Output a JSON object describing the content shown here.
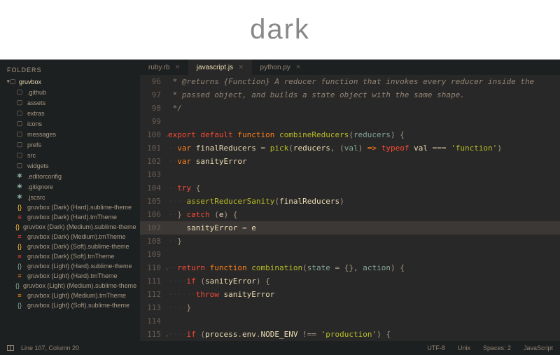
{
  "header": {
    "title": "dark"
  },
  "sidebar": {
    "heading": "FOLDERS",
    "root": "gruvbox",
    "items": [
      {
        "icon": "folder",
        "label": ".github"
      },
      {
        "icon": "folder",
        "label": "assets"
      },
      {
        "icon": "folder",
        "label": "extras"
      },
      {
        "icon": "folder",
        "label": "icons"
      },
      {
        "icon": "folder",
        "label": "messages"
      },
      {
        "icon": "folder",
        "label": "prefs"
      },
      {
        "icon": "folder",
        "label": "src"
      },
      {
        "icon": "folder",
        "label": "widgets"
      },
      {
        "icon": "conf",
        "label": ".editorconfig"
      },
      {
        "icon": "conf",
        "label": ".gitignore"
      },
      {
        "icon": "conf",
        "label": ".jscsrc"
      },
      {
        "icon": "braces-y",
        "label": "gruvbox (Dark) (Hard).sublime-theme"
      },
      {
        "icon": "settings-r",
        "label": "gruvbox (Dark) (Hard).tmTheme"
      },
      {
        "icon": "braces-y",
        "label": "gruvbox (Dark) (Medium).sublime-theme"
      },
      {
        "icon": "settings-r",
        "label": "gruvbox (Dark) (Medium).tmTheme"
      },
      {
        "icon": "braces-y",
        "label": "gruvbox (Dark) (Soft).sublime-theme"
      },
      {
        "icon": "settings-r",
        "label": "gruvbox (Dark) (Soft).tmTheme"
      },
      {
        "icon": "braces-b",
        "label": "gruvbox (Light) (Hard).sublime-theme"
      },
      {
        "icon": "settings-o",
        "label": "gruvbox (Light) (Hard).tmTheme"
      },
      {
        "icon": "braces-b",
        "label": "gruvbox (Light) (Medium).sublime-theme"
      },
      {
        "icon": "settings-o",
        "label": "gruvbox (Light) (Medium).tmTheme"
      },
      {
        "icon": "braces-b",
        "label": "gruvbox (Light) (Soft).sublime-theme"
      }
    ]
  },
  "tabs": [
    {
      "label": "ruby.rb",
      "active": false
    },
    {
      "label": "javascript.js",
      "active": true
    },
    {
      "label": "python.py",
      "active": false
    }
  ],
  "code": {
    "lines": [
      {
        "n": 96,
        "tokens": [
          [
            "comment",
            " * @returns {Function} A reducer function that invokes every reducer inside the"
          ]
        ]
      },
      {
        "n": 97,
        "tokens": [
          [
            "comment",
            " * passed object, and builds a state object with the same shape."
          ]
        ]
      },
      {
        "n": 98,
        "tokens": [
          [
            "comment",
            " */"
          ]
        ]
      },
      {
        "n": 99,
        "tokens": []
      },
      {
        "n": 100,
        "fold": true,
        "tokens": [
          [
            "kw",
            "export"
          ],
          [
            "prop",
            " "
          ],
          [
            "kw",
            "default"
          ],
          [
            "prop",
            " "
          ],
          [
            "storage",
            "function"
          ],
          [
            "prop",
            " "
          ],
          [
            "fn",
            "combineReducers"
          ],
          [
            "punc",
            "("
          ],
          [
            "param",
            "reducers"
          ],
          [
            "punc",
            ")"
          ],
          [
            "prop",
            " "
          ],
          [
            "punc",
            "{"
          ]
        ]
      },
      {
        "n": 101,
        "tokens": [
          [
            "ws",
            "··"
          ],
          [
            "storage",
            "var"
          ],
          [
            "prop",
            " finalReducers "
          ],
          [
            "punc",
            "="
          ],
          [
            "prop",
            " "
          ],
          [
            "fn",
            "pick"
          ],
          [
            "punc",
            "("
          ],
          [
            "prop",
            "reducers"
          ],
          [
            "punc",
            ", ("
          ],
          [
            "param",
            "val"
          ],
          [
            "punc",
            ")"
          ],
          [
            "prop",
            " "
          ],
          [
            "storage",
            "=>"
          ],
          [
            "prop",
            " "
          ],
          [
            "kw",
            "typeof"
          ],
          [
            "prop",
            " val "
          ],
          [
            "punc",
            "==="
          ],
          [
            "prop",
            " "
          ],
          [
            "str",
            "'function'"
          ],
          [
            "punc",
            ")"
          ]
        ]
      },
      {
        "n": 102,
        "tokens": [
          [
            "ws",
            "··"
          ],
          [
            "storage",
            "var"
          ],
          [
            "prop",
            " sanityError"
          ]
        ]
      },
      {
        "n": 103,
        "tokens": []
      },
      {
        "n": 104,
        "tokens": [
          [
            "ws",
            "··"
          ],
          [
            "kw",
            "try"
          ],
          [
            "prop",
            " "
          ],
          [
            "punc",
            "{"
          ]
        ]
      },
      {
        "n": 105,
        "tokens": [
          [
            "ws",
            "····"
          ],
          [
            "fn",
            "assertReducerSanity"
          ],
          [
            "punc",
            "("
          ],
          [
            "prop",
            "finalReducers"
          ],
          [
            "punc",
            ")"
          ]
        ]
      },
      {
        "n": 106,
        "tokens": [
          [
            "ws",
            "··"
          ],
          [
            "punc",
            "}"
          ],
          [
            "prop",
            " "
          ],
          [
            "kw",
            "catch"
          ],
          [
            "prop",
            " "
          ],
          [
            "punc",
            "("
          ],
          [
            "prop",
            "e"
          ],
          [
            "punc",
            ")"
          ],
          [
            "prop",
            " "
          ],
          [
            "punc",
            "{"
          ]
        ]
      },
      {
        "n": 107,
        "hl": true,
        "tokens": [
          [
            "ws",
            "····"
          ],
          [
            "prop",
            "sanityError "
          ],
          [
            "punc",
            "="
          ],
          [
            "prop",
            " e"
          ]
        ]
      },
      {
        "n": 108,
        "tokens": [
          [
            "ws",
            "··"
          ],
          [
            "punc",
            "}"
          ]
        ]
      },
      {
        "n": 109,
        "tokens": []
      },
      {
        "n": 110,
        "fold": true,
        "tokens": [
          [
            "ws",
            "··"
          ],
          [
            "kw",
            "return"
          ],
          [
            "prop",
            " "
          ],
          [
            "storage",
            "function"
          ],
          [
            "prop",
            " "
          ],
          [
            "fn",
            "combination"
          ],
          [
            "punc",
            "("
          ],
          [
            "param",
            "state"
          ],
          [
            "prop",
            " "
          ],
          [
            "punc",
            "="
          ],
          [
            "prop",
            " "
          ],
          [
            "punc",
            "{}, "
          ],
          [
            "param",
            "action"
          ],
          [
            "punc",
            ")"
          ],
          [
            "prop",
            " "
          ],
          [
            "punc",
            "{"
          ]
        ]
      },
      {
        "n": 111,
        "tokens": [
          [
            "ws",
            "····"
          ],
          [
            "kw",
            "if"
          ],
          [
            "prop",
            " "
          ],
          [
            "punc",
            "("
          ],
          [
            "prop",
            "sanityError"
          ],
          [
            "punc",
            ")"
          ],
          [
            "prop",
            " "
          ],
          [
            "punc",
            "{"
          ]
        ]
      },
      {
        "n": 112,
        "tokens": [
          [
            "ws",
            "······"
          ],
          [
            "kw",
            "throw"
          ],
          [
            "prop",
            " sanityError"
          ]
        ]
      },
      {
        "n": 113,
        "tokens": [
          [
            "ws",
            "····"
          ],
          [
            "punc",
            "}"
          ]
        ]
      },
      {
        "n": 114,
        "tokens": []
      },
      {
        "n": 115,
        "fold": true,
        "tokens": [
          [
            "ws",
            "····"
          ],
          [
            "kw",
            "if"
          ],
          [
            "prop",
            " "
          ],
          [
            "punc",
            "("
          ],
          [
            "prop",
            "process"
          ],
          [
            "punc",
            "."
          ],
          [
            "prop",
            "env"
          ],
          [
            "punc",
            "."
          ],
          [
            "prop",
            "NODE_ENV "
          ],
          [
            "punc",
            "!=="
          ],
          [
            "prop",
            " "
          ],
          [
            "str",
            "'production'"
          ],
          [
            "punc",
            ")"
          ],
          [
            "prop",
            " "
          ],
          [
            "punc",
            "{"
          ]
        ]
      }
    ]
  },
  "statusbar": {
    "cursor": "Line 107, Column 20",
    "encoding": "UTF-8",
    "line_endings": "Unix",
    "indent": "Spaces: 2",
    "syntax": "JavaScript"
  },
  "icon_glyphs": {
    "folder": "▢",
    "conf": "✱",
    "braces-y": "{}",
    "braces-b": "{}",
    "settings-r": "≡",
    "settings-o": "≡"
  }
}
